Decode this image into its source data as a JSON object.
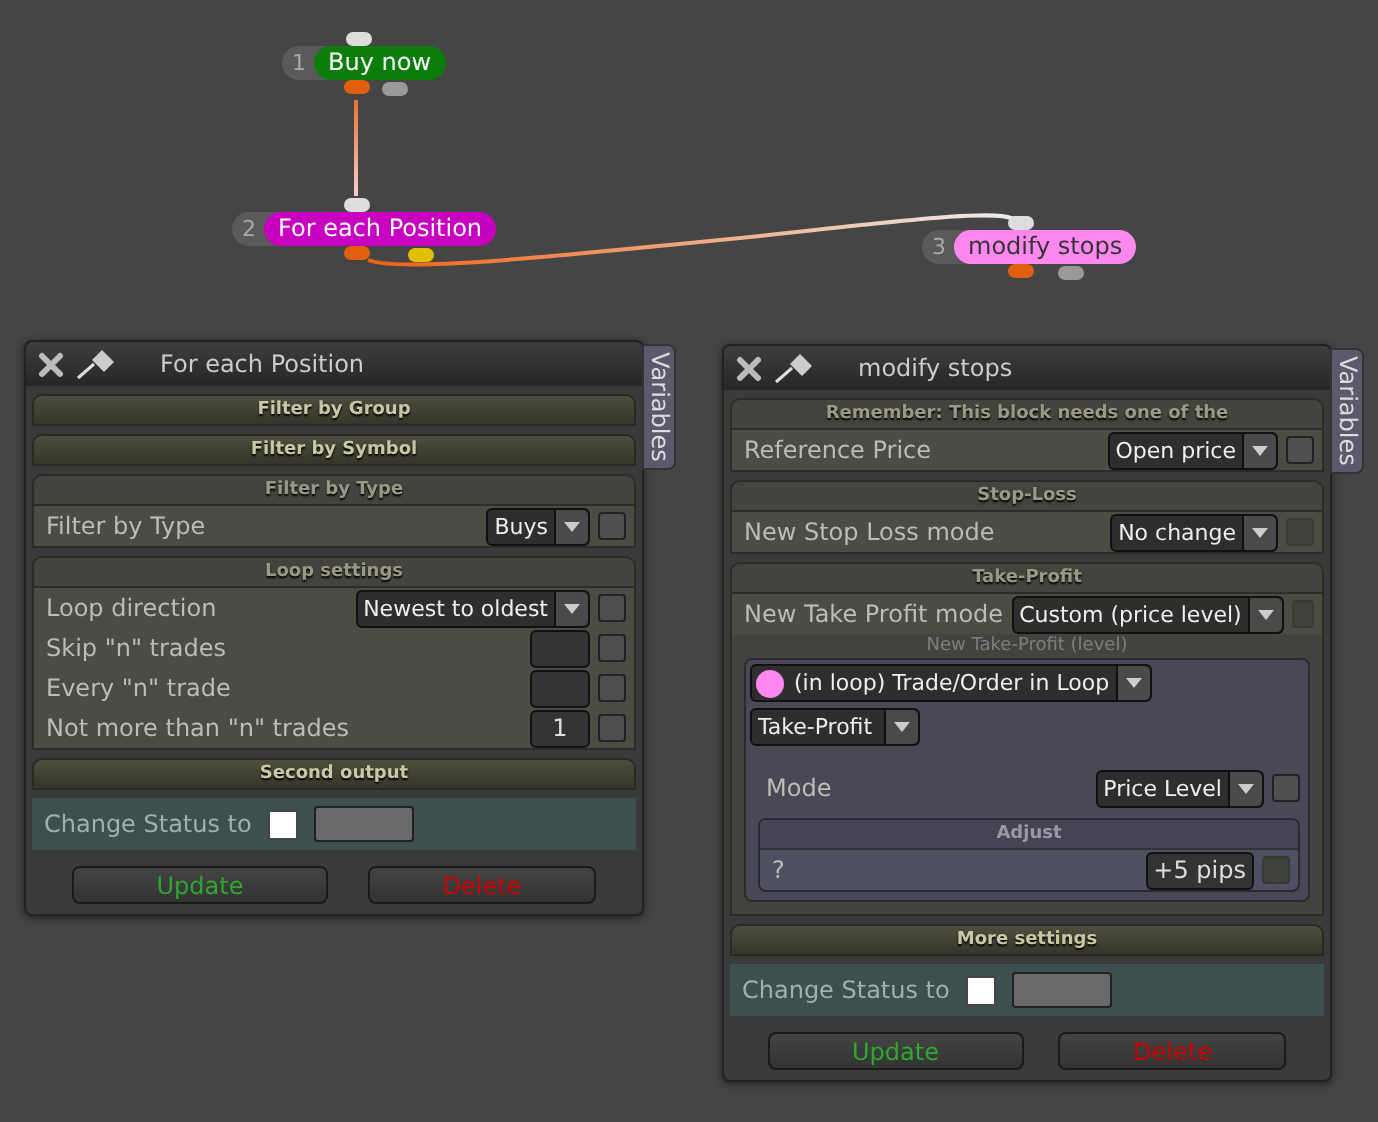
{
  "nodes": [
    {
      "number": "1",
      "label": "Buy now",
      "color": "#0a7d0a"
    },
    {
      "number": "2",
      "label": "For each Position",
      "color": "#c800c0"
    },
    {
      "number": "3",
      "label": "modify stops",
      "color": "#ff88f0"
    }
  ],
  "panels": [
    {
      "title": "For each Position",
      "side_tab": "Variables",
      "sections": [
        {
          "title": "Filter by Group",
          "expanded": false
        },
        {
          "title": "Filter by Symbol",
          "expanded": false
        },
        {
          "title": "Filter by Type",
          "expanded": true,
          "rows": [
            {
              "kind": "select",
              "label": "Filter by Type",
              "value": "Buys",
              "disabled": false,
              "checked": false
            }
          ]
        },
        {
          "title": "Loop settings",
          "expanded": true,
          "rows": [
            {
              "kind": "select",
              "label": "Loop direction",
              "value": "Newest to oldest",
              "disabled": false,
              "checked": false
            },
            {
              "kind": "number",
              "label": "Skip \"n\" trades",
              "disabled": false,
              "checked": false
            },
            {
              "kind": "number",
              "label": "Every \"n\" trade",
              "disabled": false,
              "checked": false
            },
            {
              "kind": "number",
              "label": "Not more than \"n\" trades",
              "value": "1",
              "disabled": false,
              "checked": false
            }
          ]
        },
        {
          "title": "Second output",
          "expanded": false
        }
      ],
      "status": {
        "label": "Change Status to",
        "checked": false
      },
      "buttons": [
        {
          "label": "Update",
          "kind": "update"
        },
        {
          "label": "Delete",
          "kind": "delete"
        }
      ]
    },
    {
      "title": "modify stops",
      "side_tab": "Variables",
      "sections": [
        {
          "title": "Remember: This block needs one of the",
          "expanded": true,
          "rows": [
            {
              "kind": "select",
              "label": "Reference Price",
              "value": "Open price",
              "disabled": false,
              "checked": false
            }
          ]
        },
        {
          "title": "Stop-Loss",
          "expanded": true,
          "rows": [
            {
              "kind": "select",
              "label": "New Stop Loss mode",
              "value": "No change",
              "disabled": true,
              "checked": false
            }
          ]
        },
        {
          "title": "Take-Profit",
          "expanded": true,
          "rows": [
            {
              "kind": "select",
              "label": "New Take Profit mode",
              "value": "Custom (price level)",
              "disabled": true,
              "checked": false
            },
            {
              "kind": "group",
              "title": "New Take-Profit (level)",
              "rows": [
                {
                  "kind": "source",
                  "value": "(in loop) Trade/Order in Loop",
                  "color": "#ff88f0"
                },
                {
                  "kind": "dropdown",
                  "value": "Take-Profit"
                },
                {
                  "kind": "select",
                  "label": "Mode",
                  "value": "Price Level",
                  "disabled": false,
                  "checked": false
                },
                {
                  "kind": "group",
                  "title": "Adjust",
                  "rows": [
                    {
                      "kind": "number",
                      "label": "?",
                      "value": "+5 pips",
                      "disabled": true,
                      "checked": false
                    }
                  ]
                }
              ]
            }
          ]
        },
        {
          "title": "More settings",
          "expanded": false
        }
      ],
      "status": {
        "label": "Change Status to",
        "checked": false
      },
      "buttons": [
        {
          "label": "Update",
          "kind": "update"
        },
        {
          "label": "Delete",
          "kind": "delete"
        }
      ]
    }
  ]
}
